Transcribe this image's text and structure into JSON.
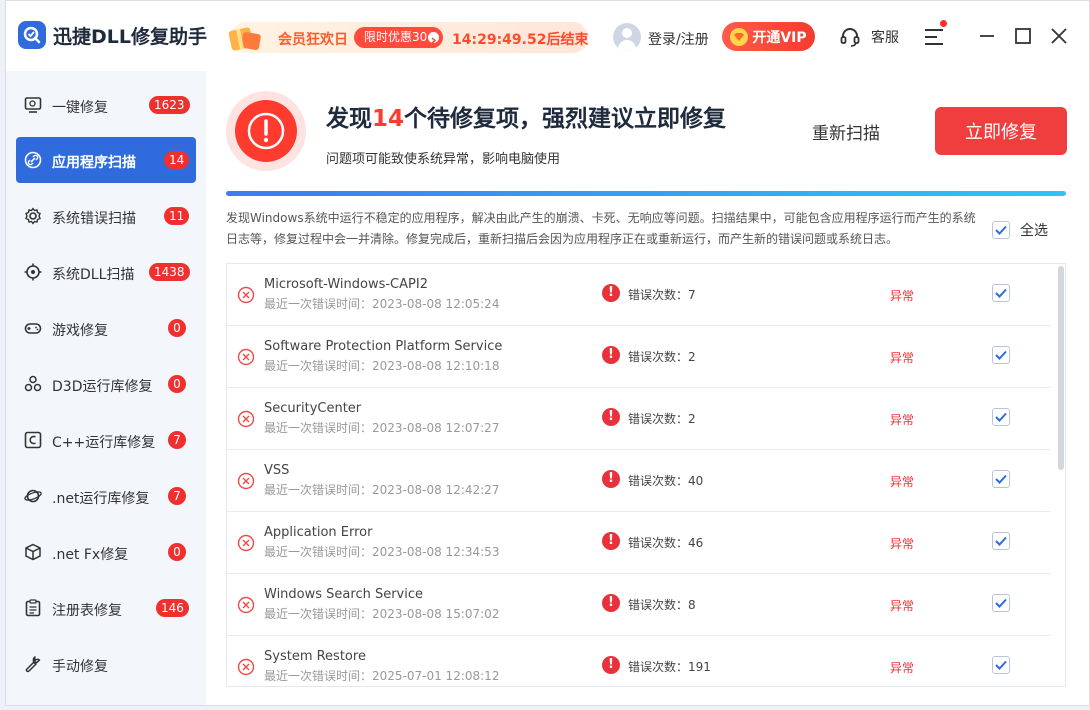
{
  "titlebar": {
    "app_title": "迅捷DLL修复助手",
    "promo": {
      "title": "会员狂欢日",
      "pill": "限时优惠30",
      "timer": "14:29:49.52后结束"
    },
    "login": "登录/注册",
    "vip": "开通VIP",
    "service": "客服"
  },
  "sidebar": {
    "items": [
      {
        "label": "一键修复",
        "badge": "1623",
        "icon": "monitor-icon"
      },
      {
        "label": "应用程序扫描",
        "badge": "14",
        "icon": "link-icon",
        "active": true
      },
      {
        "label": "系统错误扫描",
        "badge": "11",
        "icon": "gear-icon"
      },
      {
        "label": "系统DLL扫描",
        "badge": "1438",
        "icon": "target-icon"
      },
      {
        "label": "游戏修复",
        "badge": "0",
        "icon": "gamepad-icon"
      },
      {
        "label": "D3D运行库修复",
        "badge": "0",
        "icon": "cluster-icon"
      },
      {
        "label": "C++运行库修复",
        "badge": "7",
        "icon": "c-box-icon"
      },
      {
        "label": ".net运行库修复",
        "badge": "7",
        "icon": "planet-icon"
      },
      {
        "label": ".net Fx修复",
        "badge": "0",
        "icon": "cube-icon"
      },
      {
        "label": "注册表修复",
        "badge": "146",
        "icon": "clipboard-icon"
      },
      {
        "label": "手动修复",
        "badge": "",
        "icon": "wrench-icon"
      }
    ]
  },
  "main": {
    "headline_pre": "发现",
    "headline_num": "14",
    "headline_post": "个待修复项，强烈建议立即修复",
    "subline": "问题项可能致使系统异常，影响电脑使用",
    "rescan": "重新扫描",
    "fix_now": "立即修复",
    "progress": 1.0,
    "description": "发现Windows系统中运行不稳定的应用程序，解决由此产生的崩溃、卡死、无响应等问题。扫描结果中，可能包含应用程序运行而产生的系统日志等，修复过程中会一并清除。修复完成后，重新扫描后会因为应用程序正在或重新运行，而产生新的错误问题或系统日志。",
    "select_all": "全选",
    "select_all_checked": true,
    "rows": [
      {
        "name": "Microsoft-Windows-CAPI2",
        "time": "最近一次错误时间：2023-08-08 12:05:24",
        "count": "错误次数：7",
        "status": "异常",
        "checked": true
      },
      {
        "name": "Software Protection Platform Service",
        "time": "最近一次错误时间：2023-08-08 12:10:18",
        "count": "错误次数：2",
        "status": "异常",
        "checked": true
      },
      {
        "name": "SecurityCenter",
        "time": "最近一次错误时间：2023-08-08 12:07:27",
        "count": "错误次数：2",
        "status": "异常",
        "checked": true
      },
      {
        "name": "VSS",
        "time": "最近一次错误时间：2023-08-08 12:42:27",
        "count": "错误次数：40",
        "status": "异常",
        "checked": true
      },
      {
        "name": "Application Error",
        "time": "最近一次错误时间：2023-08-08 12:34:53",
        "count": "错误次数：46",
        "status": "异常",
        "checked": true
      },
      {
        "name": "Windows Search Service",
        "time": "最近一次错误时间：2023-08-08 15:07:02",
        "count": "错误次数：8",
        "status": "异常",
        "checked": true
      },
      {
        "name": "System Restore",
        "time": "最近一次错误时间：2025-07-01 12:08:12",
        "count": "错误次数：191",
        "status": "异常",
        "checked": true
      }
    ]
  },
  "colors": {
    "accent": "#2f6bdc",
    "danger": "#f03e3e",
    "badge": "#f02f2f"
  }
}
